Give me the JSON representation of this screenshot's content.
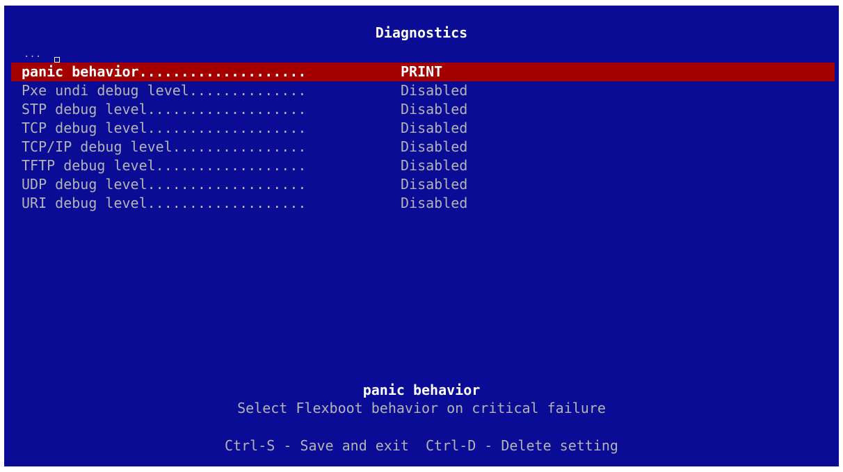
{
  "title": "Diagnostics",
  "scroll_indicator": "...",
  "menu": {
    "items": [
      {
        "label": "panic behavior....................",
        "value": "PRINT",
        "selected": true
      },
      {
        "label": "Pxe undi debug level..............",
        "value": "Disabled"
      },
      {
        "label": "STP debug level...................",
        "value": "Disabled"
      },
      {
        "label": "TCP debug level...................",
        "value": "Disabled"
      },
      {
        "label": "TCP/IP debug level................",
        "value": "Disabled"
      },
      {
        "label": "TFTP debug level..................",
        "value": "Disabled"
      },
      {
        "label": "UDP debug level...................",
        "value": "Disabled"
      },
      {
        "label": "URI debug level...................",
        "value": "Disabled"
      }
    ]
  },
  "help": {
    "title": "panic behavior",
    "text": "Select Flexboot behavior on critical failure"
  },
  "keys": {
    "text": "Ctrl-S - Save and exit  Ctrl-D - Delete setting"
  },
  "colors": {
    "background": "#0a0c96",
    "selection": "#a40000",
    "text": "#b4b4b4",
    "highlight_text": "#ffffff"
  }
}
